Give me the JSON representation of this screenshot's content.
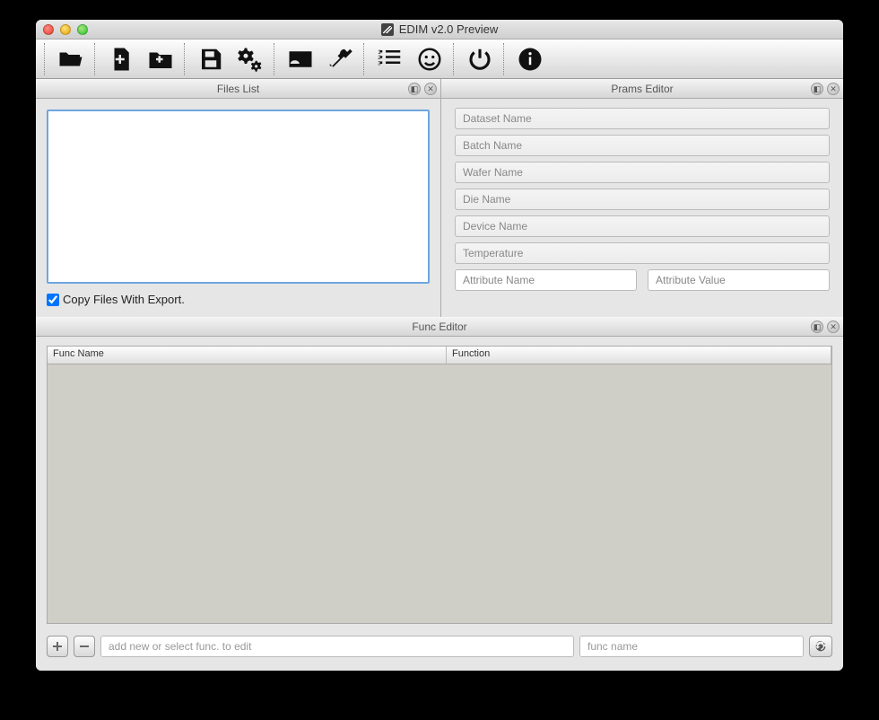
{
  "window": {
    "title": "EDIM v2.0 Preview"
  },
  "panels": {
    "files": {
      "title": "Files List",
      "checkbox_label": "Copy Files With Export."
    },
    "prams": {
      "title": "Prams Editor",
      "fields": {
        "dataset": "Dataset Name",
        "batch": "Batch Name",
        "wafer": "Wafer Name",
        "die": "Die Name",
        "device": "Device Name",
        "temperature": "Temperature",
        "attr_name": "Attribute Name",
        "attr_value": "Attribute Value"
      }
    },
    "func": {
      "title": "Func Editor",
      "columns": {
        "name": "Func Name",
        "function": "Function"
      },
      "footer": {
        "add_placeholder": "add new or select func. to edit",
        "name_placeholder": "func name"
      }
    }
  }
}
